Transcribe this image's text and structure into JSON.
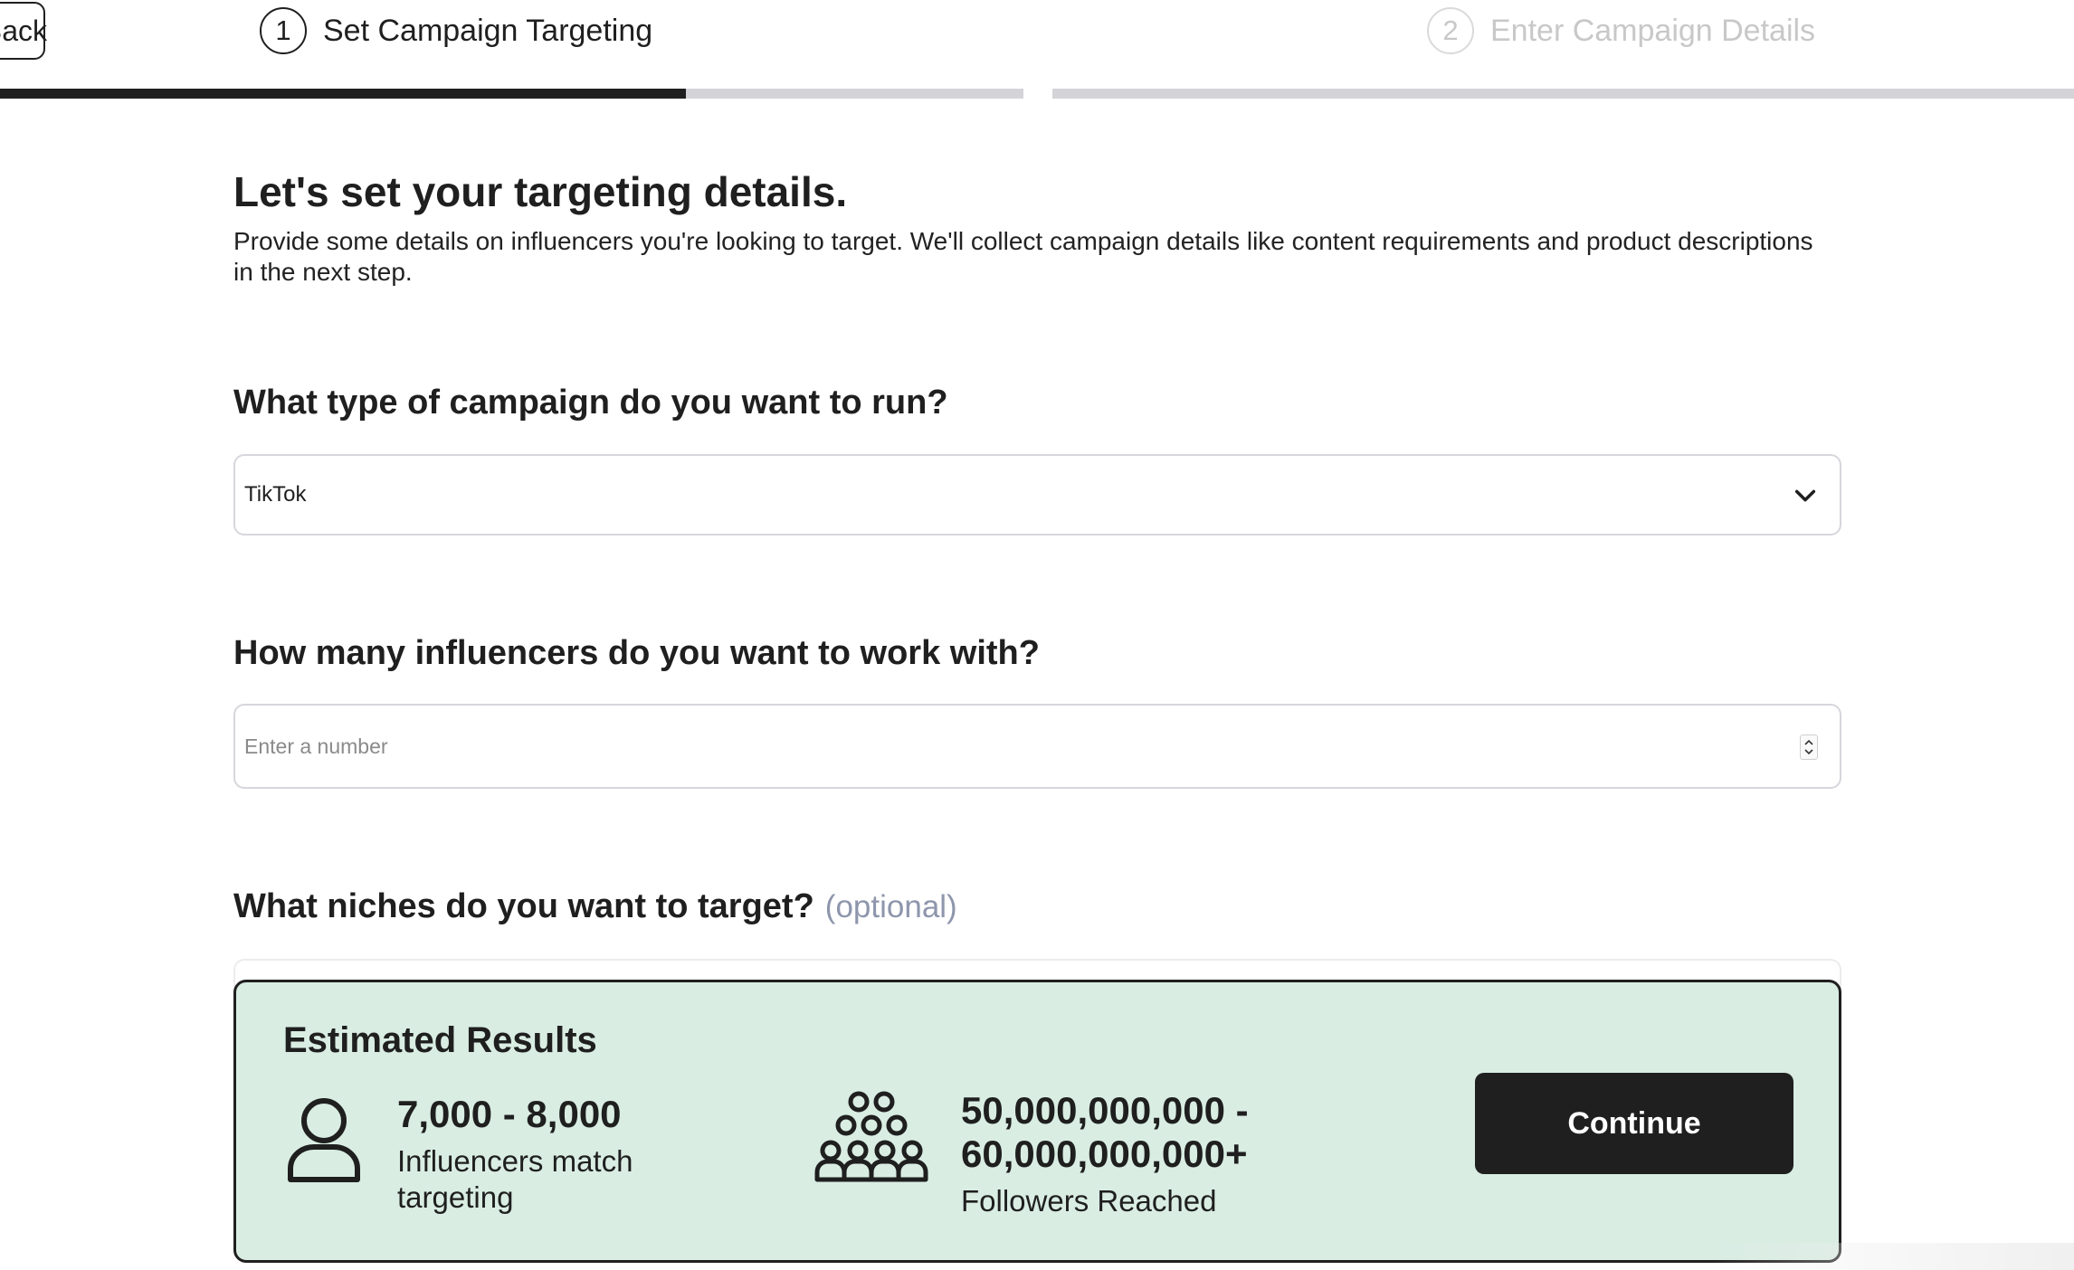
{
  "header": {
    "back_label": "Back",
    "steps": [
      {
        "number": "1",
        "label": "Set Campaign Targeting",
        "active": true
      },
      {
        "number": "2",
        "label": "Enter Campaign Details",
        "active": false
      }
    ],
    "step1_progress_fraction": 0.67
  },
  "intro": {
    "title": "Let's set your targeting details.",
    "description": "Provide some details on influencers you're looking to target. We'll collect campaign details like content requirements and product descriptions in the next step."
  },
  "campaign_type": {
    "question": "What type of campaign do you want to run?",
    "selected": "TikTok"
  },
  "influencer_count": {
    "question": "How many influencers do you want to work with?",
    "placeholder": "Enter a number",
    "value": ""
  },
  "niches": {
    "question": "What niches do you want to target?",
    "optional_label": "(optional)"
  },
  "results": {
    "title": "Estimated Results",
    "influencers_value": "7,000 - 8,000",
    "influencers_label": "Influencers match targeting",
    "followers_value": "50,000,000,000 - 60,000,000,000+",
    "followers_label": "Followers Reached",
    "continue_label": "Continue"
  },
  "colors": {
    "accent_dark": "#1f1f1f",
    "results_bg": "#d9ede3",
    "muted_text": "#c8c8c8",
    "optional_text": "#8e96ad"
  },
  "icons": [
    "person-icon",
    "crowd-icon",
    "chevron-down-icon",
    "spinner-icon"
  ]
}
